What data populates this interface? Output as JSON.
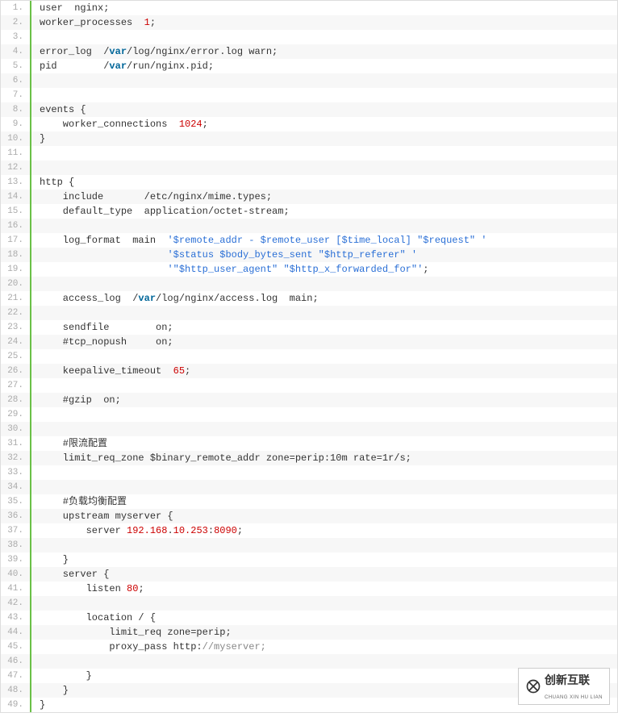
{
  "lines": [
    {
      "n": "1.",
      "segments": [
        {
          "t": "user  nginx;",
          "c": ""
        }
      ]
    },
    {
      "n": "2.",
      "segments": [
        {
          "t": "worker_processes  ",
          "c": ""
        },
        {
          "t": "1",
          "c": "num"
        },
        {
          "t": ";",
          "c": ""
        }
      ]
    },
    {
      "n": "3.",
      "segments": [
        {
          "t": "",
          "c": ""
        }
      ]
    },
    {
      "n": "4.",
      "segments": [
        {
          "t": "error_log  /",
          "c": ""
        },
        {
          "t": "var",
          "c": "kw"
        },
        {
          "t": "/log/nginx/error.log warn;",
          "c": ""
        }
      ]
    },
    {
      "n": "5.",
      "segments": [
        {
          "t": "pid        /",
          "c": ""
        },
        {
          "t": "var",
          "c": "kw"
        },
        {
          "t": "/run/nginx.pid;",
          "c": ""
        }
      ]
    },
    {
      "n": "6.",
      "segments": [
        {
          "t": "",
          "c": ""
        }
      ]
    },
    {
      "n": "7.",
      "segments": [
        {
          "t": "",
          "c": ""
        }
      ]
    },
    {
      "n": "8.",
      "segments": [
        {
          "t": "events {",
          "c": ""
        }
      ]
    },
    {
      "n": "9.",
      "segments": [
        {
          "t": "    worker_connections  ",
          "c": ""
        },
        {
          "t": "1024",
          "c": "num"
        },
        {
          "t": ";",
          "c": ""
        }
      ]
    },
    {
      "n": "10.",
      "segments": [
        {
          "t": "}",
          "c": ""
        }
      ]
    },
    {
      "n": "11.",
      "segments": [
        {
          "t": "",
          "c": ""
        }
      ]
    },
    {
      "n": "12.",
      "segments": [
        {
          "t": "",
          "c": ""
        }
      ]
    },
    {
      "n": "13.",
      "segments": [
        {
          "t": "http {",
          "c": ""
        }
      ]
    },
    {
      "n": "14.",
      "segments": [
        {
          "t": "    include       /etc/nginx/mime.types;",
          "c": ""
        }
      ]
    },
    {
      "n": "15.",
      "segments": [
        {
          "t": "    default_type  application/octet-stream;",
          "c": ""
        }
      ]
    },
    {
      "n": "16.",
      "segments": [
        {
          "t": "",
          "c": ""
        }
      ]
    },
    {
      "n": "17.",
      "segments": [
        {
          "t": "    log_format  main  ",
          "c": ""
        },
        {
          "t": "'$remote_addr - $remote_user [$time_local] \"$request\" '",
          "c": "str"
        }
      ]
    },
    {
      "n": "18.",
      "segments": [
        {
          "t": "                      ",
          "c": ""
        },
        {
          "t": "'$status $body_bytes_sent \"$http_referer\" '",
          "c": "str"
        }
      ]
    },
    {
      "n": "19.",
      "segments": [
        {
          "t": "                      ",
          "c": ""
        },
        {
          "t": "'\"$http_user_agent\" \"$http_x_forwarded_for\"'",
          "c": "str"
        },
        {
          "t": ";",
          "c": ""
        }
      ]
    },
    {
      "n": "20.",
      "segments": [
        {
          "t": "",
          "c": ""
        }
      ]
    },
    {
      "n": "21.",
      "segments": [
        {
          "t": "    access_log  /",
          "c": ""
        },
        {
          "t": "var",
          "c": "kw"
        },
        {
          "t": "/log/nginx/access.log  main;",
          "c": ""
        }
      ]
    },
    {
      "n": "22.",
      "segments": [
        {
          "t": "",
          "c": ""
        }
      ]
    },
    {
      "n": "23.",
      "segments": [
        {
          "t": "    sendfile        on;",
          "c": ""
        }
      ]
    },
    {
      "n": "24.",
      "segments": [
        {
          "t": "    #tcp_nopush     on;",
          "c": ""
        }
      ]
    },
    {
      "n": "25.",
      "segments": [
        {
          "t": "",
          "c": ""
        }
      ]
    },
    {
      "n": "26.",
      "segments": [
        {
          "t": "    keepalive_timeout  ",
          "c": ""
        },
        {
          "t": "65",
          "c": "num"
        },
        {
          "t": ";",
          "c": ""
        }
      ]
    },
    {
      "n": "27.",
      "segments": [
        {
          "t": "",
          "c": ""
        }
      ]
    },
    {
      "n": "28.",
      "segments": [
        {
          "t": "    #gzip  on;",
          "c": ""
        }
      ]
    },
    {
      "n": "29.",
      "segments": [
        {
          "t": "    ",
          "c": ""
        }
      ]
    },
    {
      "n": "30.",
      "segments": [
        {
          "t": "    ",
          "c": ""
        }
      ]
    },
    {
      "n": "31.",
      "segments": [
        {
          "t": "    #限流配置",
          "c": ""
        }
      ]
    },
    {
      "n": "32.",
      "segments": [
        {
          "t": "    limit_req_zone $binary_remote_addr zone=perip:10m rate=1r/s;",
          "c": ""
        }
      ]
    },
    {
      "n": "33.",
      "segments": [
        {
          "t": "",
          "c": ""
        }
      ]
    },
    {
      "n": "34.",
      "segments": [
        {
          "t": "",
          "c": ""
        }
      ]
    },
    {
      "n": "35.",
      "segments": [
        {
          "t": "    #负载均衡配置",
          "c": ""
        }
      ]
    },
    {
      "n": "36.",
      "segments": [
        {
          "t": "    upstream myserver {",
          "c": ""
        }
      ]
    },
    {
      "n": "37.",
      "segments": [
        {
          "t": "        server ",
          "c": ""
        },
        {
          "t": "192.168",
          "c": "num"
        },
        {
          "t": ".",
          "c": ""
        },
        {
          "t": "10.253",
          "c": "num"
        },
        {
          "t": ":",
          "c": ""
        },
        {
          "t": "8090",
          "c": "num"
        },
        {
          "t": ";",
          "c": ""
        }
      ]
    },
    {
      "n": "38.",
      "segments": [
        {
          "t": "",
          "c": ""
        }
      ]
    },
    {
      "n": "39.",
      "segments": [
        {
          "t": "    }",
          "c": ""
        }
      ]
    },
    {
      "n": "40.",
      "segments": [
        {
          "t": "    server {",
          "c": ""
        }
      ]
    },
    {
      "n": "41.",
      "segments": [
        {
          "t": "        listen ",
          "c": ""
        },
        {
          "t": "80",
          "c": "num"
        },
        {
          "t": ";",
          "c": ""
        }
      ]
    },
    {
      "n": "42.",
      "segments": [
        {
          "t": "",
          "c": ""
        }
      ]
    },
    {
      "n": "43.",
      "segments": [
        {
          "t": "        location / {",
          "c": ""
        }
      ]
    },
    {
      "n": "44.",
      "segments": [
        {
          "t": "            limit_req zone=perip;",
          "c": ""
        }
      ]
    },
    {
      "n": "45.",
      "segments": [
        {
          "t": "            proxy_pass http:",
          "c": ""
        },
        {
          "t": "//myserver;",
          "c": "hl-grey"
        }
      ]
    },
    {
      "n": "46.",
      "segments": [
        {
          "t": "",
          "c": ""
        }
      ]
    },
    {
      "n": "47.",
      "segments": [
        {
          "t": "        }",
          "c": ""
        }
      ]
    },
    {
      "n": "48.",
      "segments": [
        {
          "t": "    }",
          "c": ""
        }
      ]
    },
    {
      "n": "49.",
      "segments": [
        {
          "t": "}",
          "c": ""
        }
      ]
    }
  ],
  "logo": {
    "text": "创新互联",
    "sub": "CHUANG XIN HU LIAN"
  }
}
